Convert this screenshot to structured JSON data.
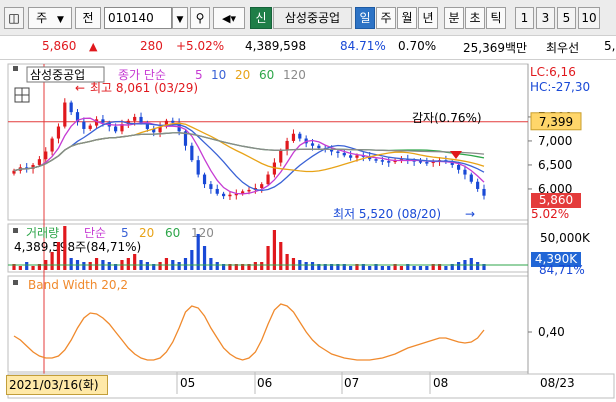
{
  "toolbar": {
    "period_select": "주",
    "market_select": "전",
    "stock_code": "010140",
    "new_badge": "신",
    "stock_name": "삼성중공업",
    "periods": [
      "일",
      "주",
      "월",
      "년",
      "분",
      "초",
      "틱"
    ],
    "selected_period": "일",
    "minutes": [
      "1",
      "3",
      "5",
      "10"
    ]
  },
  "info": {
    "price": "5,860",
    "change_arrow": "▲",
    "change": "280",
    "change_pct": "+5.02%",
    "volume": "4,389,598",
    "ratio": "84.71%",
    "turnover": "0.70%",
    "amount": "25,369백만",
    "lowest_label": "최우선",
    "extra": "5,"
  },
  "price_panel": {
    "icon_label": "삼성중공업",
    "ma_title": "종가 단순",
    "ma_periods": [
      "5",
      "10",
      "20",
      "60",
      "120"
    ],
    "ma_colors": [
      "#c63cd3",
      "#3a62d6",
      "#e8a317",
      "#2ea64a",
      "#8a8a8a"
    ],
    "high_annotation": "최고 8,061 (03/29)",
    "low_annotation": "최저 5,520 (08/20)",
    "capital_reduction": "감자(0.76%)",
    "lc": "LC:6,16",
    "hc": "HC:-27,30",
    "axis_labels": [
      "7,500",
      "7,000",
      "6,500",
      "6,000"
    ],
    "marker_value": "7,399",
    "current_price": "5,860",
    "current_pct": "5.02%"
  },
  "volume_panel": {
    "title": "거래량",
    "ma_title": "단순",
    "ma_periods": [
      "5",
      "20",
      "60",
      "120"
    ],
    "value_line": "4,389,598주(84,71%)",
    "axis_label": "50,000K",
    "current_value": "4,390K",
    "current_pct": "84,71%"
  },
  "band_panel": {
    "title": "Band Width 20,2",
    "axis_label": "0,40"
  },
  "x_axis": {
    "cursor_date": "2021/03/16(화)",
    "months": [
      "05",
      "06",
      "07",
      "08"
    ],
    "end_date": "08/23"
  },
  "colors": {
    "up": "#e0181d",
    "down": "#1949d6",
    "resistance": "#e43b3b",
    "band": "#f08a2d"
  }
}
